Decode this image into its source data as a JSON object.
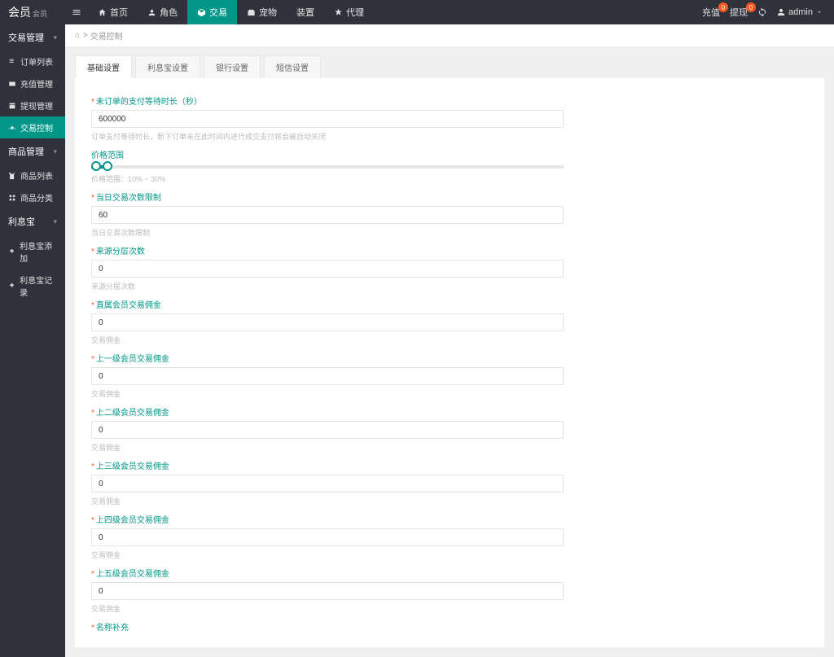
{
  "brand": {
    "main": "会员",
    "sub": "会员"
  },
  "topnav": {
    "items": [
      {
        "label": "首页"
      },
      {
        "label": "角色"
      },
      {
        "label": "交易",
        "active": true
      },
      {
        "label": "宠物"
      },
      {
        "label": "装置"
      },
      {
        "label": "代理"
      }
    ]
  },
  "topright": {
    "link1": "充值",
    "badge1": "0",
    "link2": "提现",
    "badge2": "0",
    "user": "admin"
  },
  "sidebar": {
    "groups": [
      {
        "label": "交易管理",
        "items": [
          {
            "label": "订单列表"
          },
          {
            "label": "充值管理"
          },
          {
            "label": "提现管理"
          },
          {
            "label": "交易控制",
            "active": true
          }
        ]
      },
      {
        "label": "商品管理",
        "items": [
          {
            "label": "商品列表"
          },
          {
            "label": "商品分类"
          }
        ]
      },
      {
        "label": "利息宝",
        "items": [
          {
            "label": "利息宝添加"
          },
          {
            "label": "利息宝记录"
          }
        ]
      }
    ]
  },
  "breadcrumb": {
    "page": "交易控制"
  },
  "tabs": {
    "items": [
      {
        "label": "基础设置",
        "active": true
      },
      {
        "label": "利息宝设置"
      },
      {
        "label": "银行设置"
      },
      {
        "label": "短信设置"
      }
    ]
  },
  "form": {
    "f1": {
      "label": "未订单的支付等待时长（秒）",
      "value": "600000",
      "help": "订单支付等待时长，新下订单未在此时间内进行成交支付将会被自动关闭"
    },
    "slider": {
      "label": "价格范围",
      "caption": "价格范围：10% ~ 30%"
    },
    "f2": {
      "label": "当日交易次数限制",
      "value": "60",
      "help": "当日交易次数限制"
    },
    "f3": {
      "label": "来源分层次数",
      "value": "0",
      "help": "来源分层次数"
    },
    "f4": {
      "label": "直属会员交易佣金",
      "value": "0",
      "help": "交易佣金"
    },
    "f5": {
      "label": "上一级会员交易佣金",
      "value": "0",
      "help": "交易佣金"
    },
    "f6": {
      "label": "上二级会员交易佣金",
      "value": "0",
      "help": "交易佣金"
    },
    "f7": {
      "label": "上三级会员交易佣金",
      "value": "0",
      "help": "交易佣金"
    },
    "f8": {
      "label": "上四级会员交易佣金",
      "value": "0",
      "help": "交易佣金"
    },
    "f9": {
      "label": "上五级会员交易佣金",
      "value": "0",
      "help": "交易佣金"
    },
    "f10": {
      "label": "名称补充"
    }
  }
}
